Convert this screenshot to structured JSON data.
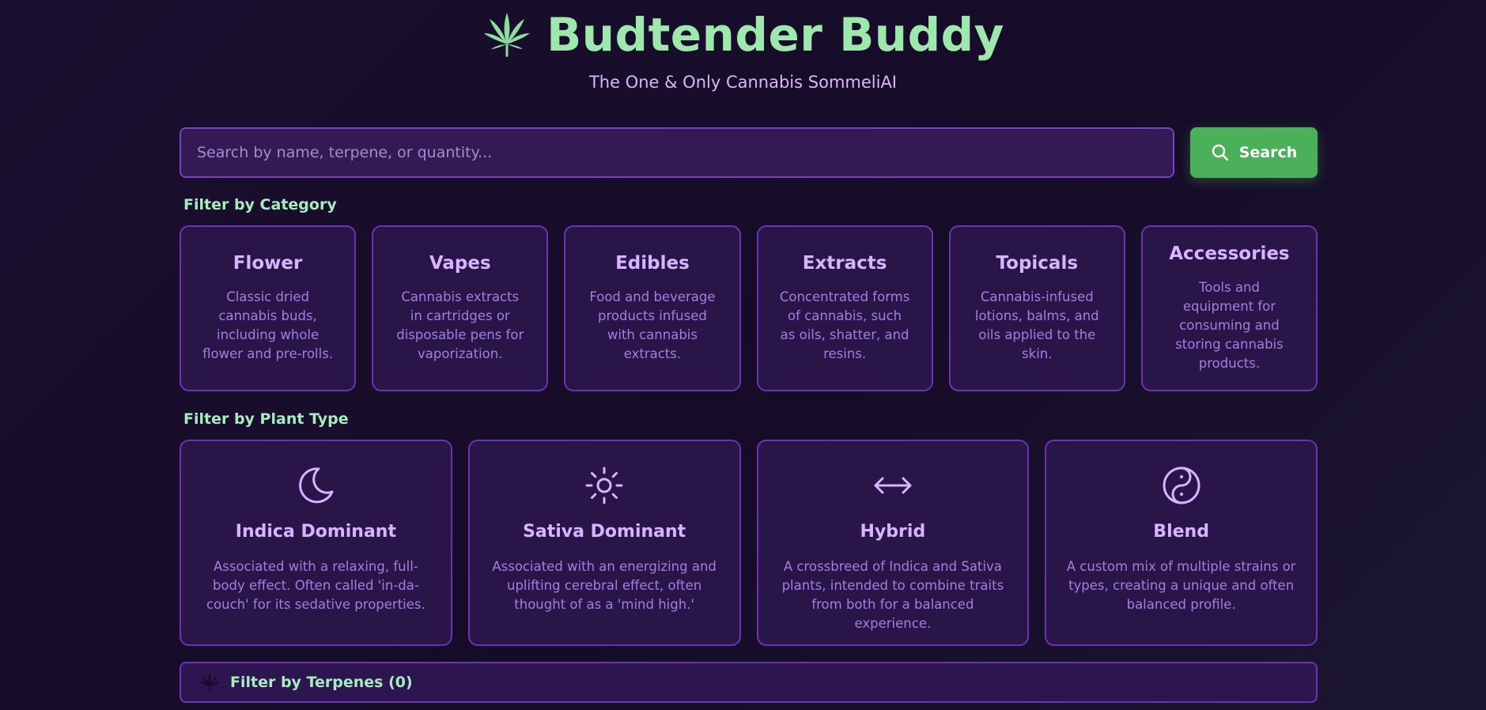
{
  "header": {
    "logo_icon": "cannabis-leaf-icon",
    "title": "Budtender Buddy",
    "subtitle": "The One & Only Cannabis SommeliAI"
  },
  "search": {
    "placeholder": "Search by name, terpene, or quantity...",
    "value": "",
    "button_label": "Search",
    "button_icon": "search-icon"
  },
  "category_section": {
    "label": "Filter by Category",
    "items": [
      {
        "title": "Flower",
        "description": "Classic dried cannabis buds, including whole flower and pre-rolls."
      },
      {
        "title": "Vapes",
        "description": "Cannabis extracts in cartridges or disposable pens for vaporization."
      },
      {
        "title": "Edibles",
        "description": "Food and beverage products infused with cannabis extracts."
      },
      {
        "title": "Extracts",
        "description": "Concentrated forms of cannabis, such as oils, shatter, and resins."
      },
      {
        "title": "Topicals",
        "description": "Cannabis-infused lotions, balms, and oils applied to the skin."
      },
      {
        "title": "Accessories",
        "description": "Tools and equipment for consuming and storing cannabis products."
      }
    ]
  },
  "plant_section": {
    "label": "Filter by Plant Type",
    "items": [
      {
        "icon": "moon-icon",
        "title": "Indica Dominant",
        "description": "Associated with a relaxing, full-body effect. Often called 'in-da-couch' for its sedative properties."
      },
      {
        "icon": "sun-icon",
        "title": "Sativa Dominant",
        "description": "Associated with an energizing and uplifting cerebral effect, often thought of as a 'mind high.'"
      },
      {
        "icon": "arrows-horizontal-icon",
        "title": "Hybrid",
        "description": "A crossbreed of Indica and Sativa plants, intended to combine traits from both for a balanced experience."
      },
      {
        "icon": "yin-yang-icon",
        "title": "Blend",
        "description": "A custom mix of multiple strains or types, creating a unique and often balanced profile."
      }
    ]
  },
  "terpenes": {
    "label": "Filter by Terpenes (0)",
    "icon": "cannabis-leaf-icon"
  },
  "colors": {
    "title_green": "#9ee8ad",
    "accent_purple": "#d8b4fe",
    "button_green": "#4caf5a",
    "background": "#1a0f2e"
  }
}
